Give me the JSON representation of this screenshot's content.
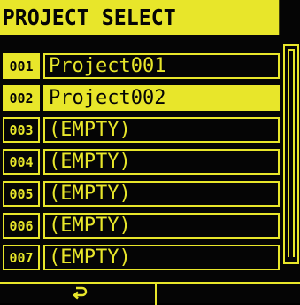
{
  "title": "PROJECT SELECT",
  "projects": [
    {
      "num": "001",
      "name": "Project001"
    },
    {
      "num": "002",
      "name": "Project002"
    },
    {
      "num": "003",
      "name": "(EMPTY)"
    },
    {
      "num": "004",
      "name": "(EMPTY)"
    },
    {
      "num": "005",
      "name": "(EMPTY)"
    },
    {
      "num": "006",
      "name": "(EMPTY)"
    },
    {
      "num": "007",
      "name": "(EMPTY)"
    }
  ],
  "selected_index": 1,
  "footer": {
    "back_icon": "return-arrow-icon"
  },
  "colors": {
    "accent": "#e8e62a",
    "background": "#050505"
  }
}
